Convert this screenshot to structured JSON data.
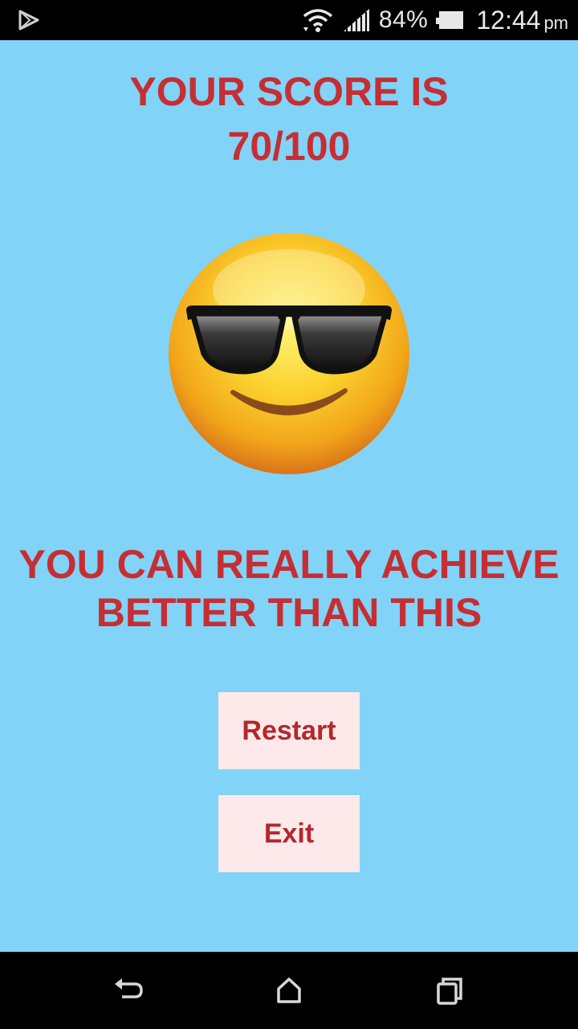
{
  "status_bar": {
    "battery_percent": "84%",
    "time": "12:44",
    "time_suffix": "pm",
    "icons": [
      "play-store-icon",
      "wifi-icon",
      "signal-icon",
      "battery-icon"
    ]
  },
  "result": {
    "score_label": "YOUR SCORE IS",
    "score_value": "70/100",
    "emoji": "smiling-face-with-sunglasses",
    "message_line1": "YOU CAN REALLY ACHIEVE",
    "message_line2": "BETTER THAN THIS"
  },
  "buttons": {
    "restart_label": "Restart",
    "exit_label": "Exit"
  },
  "nav_bar": {
    "icons": [
      "back-icon",
      "home-icon",
      "recents-icon"
    ]
  },
  "colors": {
    "background": "#81d4f7",
    "text_accent": "#c62e34",
    "button_bg": "#fde9ea",
    "button_text": "#b3282c"
  }
}
